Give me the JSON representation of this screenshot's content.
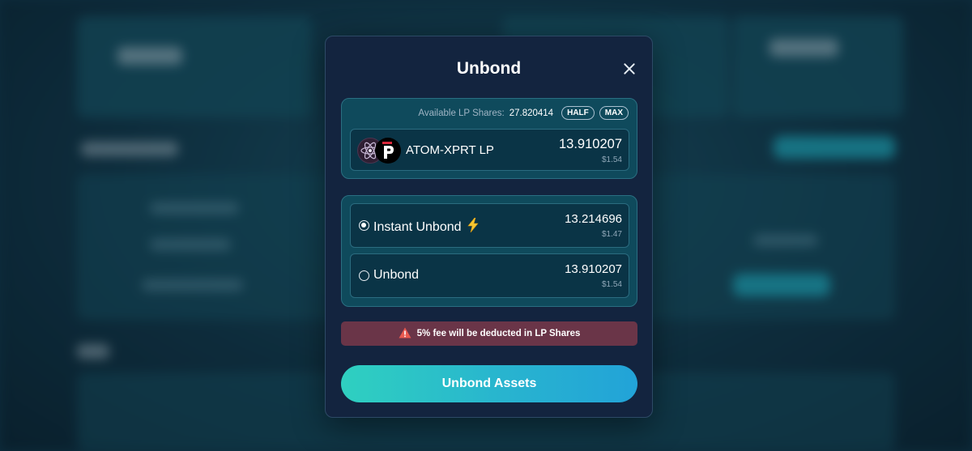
{
  "modal": {
    "title": "Unbond",
    "available_label": "Available LP Shares:",
    "available_value": "27.820414",
    "half_label": "HALF",
    "max_label": "MAX",
    "asset": {
      "name": "ATOM-XPRT LP",
      "amount": "13.910207",
      "usd": "$1.54",
      "icons": [
        "cosmos-atom-icon",
        "persistence-xprt-icon"
      ]
    },
    "options": [
      {
        "label": "Instant Unbond",
        "icon": "lightning-icon",
        "amount": "13.214696",
        "usd": "$1.47",
        "selected": true
      },
      {
        "label": "Unbond",
        "amount": "13.910207",
        "usd": "$1.54",
        "selected": false
      }
    ],
    "fee_warning": "5% fee will be deducted in LP Shares",
    "submit_label": "Unbond Assets"
  },
  "colors": {
    "modal_bg": "#13243f",
    "panel_bg": "#0f4a5c",
    "warning_bg": "#6a3548",
    "cta_start": "#2fd0c0",
    "cta_end": "#22a3d8"
  }
}
